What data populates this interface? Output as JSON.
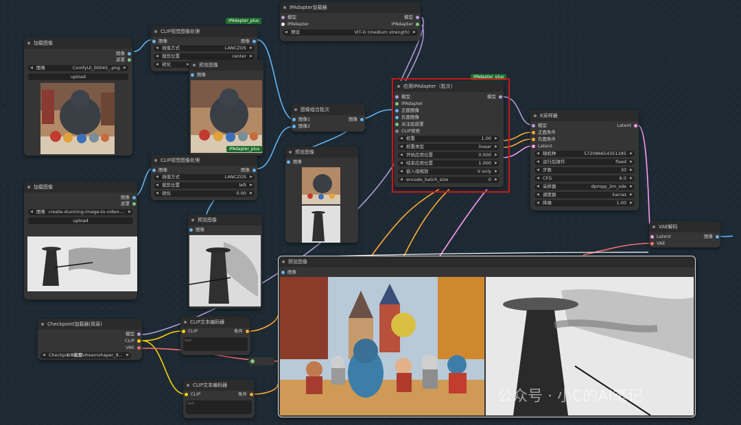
{
  "badges": {
    "ipadapter_plus_1": "IPAdapter_plus",
    "ipadapter_plus_2": "IPAdapter_plus",
    "ipadapter_plus_3": "IPAdapter_plus"
  },
  "load_image_1": {
    "title": "加载图像",
    "out_image": "图像",
    "out_mask": "遮罩",
    "image_label": "图像",
    "image_value": "ComfyUI_00045_.png",
    "upload": "upload"
  },
  "load_image_2": {
    "title": "加载图像",
    "out_image": "图像",
    "out_mask": "遮罩",
    "image_label": "图像",
    "image_value": "create-stunning-image-to-video-...",
    "upload": "upload"
  },
  "clip_prep_1": {
    "title": "CLIP视觉图像处理",
    "in_image": "图像",
    "out_image": "图像",
    "w1_label": "插值方式",
    "w1_value": "LANCZOS",
    "w2_label": "裁剪位置",
    "w2_value": "center",
    "w3_label": "锐化"
  },
  "clip_prep_2": {
    "title": "CLIP视觉图像处理",
    "in_image": "图像",
    "out_image": "图像",
    "w1_label": "插值方式",
    "w1_value": "LANCZOS",
    "w2_label": "裁剪位置",
    "w2_value": "left",
    "w3_label": "锐化",
    "w3_value": "0.00"
  },
  "preview_1": {
    "title": "预览图像",
    "in_image": "图像"
  },
  "preview_2": {
    "title": "预览图像",
    "in_image": "图像"
  },
  "preview_3": {
    "title": "预览图像",
    "in_image": "图像"
  },
  "preview_4": {
    "title": "预览图像",
    "in_image": "图像"
  },
  "batch": {
    "title": "图像组合批次",
    "in1": "图像1",
    "in2": "图像2",
    "out": "图像"
  },
  "ipa_loader": {
    "title": "IPAdapter加载器",
    "in_model": "模型",
    "in_ipa": "IPAdapter",
    "out_model": "模型",
    "out_ipa": "IPAdapter",
    "preset_label": "预设",
    "preset_value": "VIT-G (medium strength)"
  },
  "apply_ipa": {
    "title": "应用IPAdapter（批次）",
    "inputs": [
      "模型",
      "IPAdapter",
      "正面图像",
      "负面图像",
      "关注层遮罩",
      "CLIP视觉"
    ],
    "out_model": "模型",
    "widgets": [
      {
        "label": "权重",
        "value": "1.00"
      },
      {
        "label": "权重类型",
        "value": "linear"
      },
      {
        "label": "开始应用位置",
        "value": "0.000"
      },
      {
        "label": "结束应用位置",
        "value": "1.000"
      },
      {
        "label": "嵌入组缩放",
        "value": "V only"
      },
      {
        "label": "encode_batch_size",
        "value": "0"
      }
    ]
  },
  "ksampler": {
    "title": "K采样器",
    "inputs": [
      "模型",
      "正面条件",
      "负面条件",
      "Latent"
    ],
    "out": "Latent",
    "widgets": [
      {
        "label": "随机种",
        "value": "572086654351285"
      },
      {
        "label": "运行后操作",
        "value": "fixed"
      },
      {
        "label": "步数",
        "value": "30"
      },
      {
        "label": "CFG",
        "value": "6.0"
      },
      {
        "label": "采样器",
        "value": "dpmpp_2m_sde"
      },
      {
        "label": "调度器",
        "value": "karras"
      },
      {
        "label": "降噪",
        "value": "1.00"
      }
    ]
  },
  "vae_decode": {
    "title": "VAE解码",
    "in_latent": "Latent",
    "in_vae": "VAE",
    "out": "图像"
  },
  "checkpoint": {
    "title": "Checkpoint加载器(简易)",
    "out_model": "模型",
    "out_clip": "CLIP",
    "out_vae": "VAE",
    "ckpt_label": "Checkpoint名称",
    "ckpt_value": "1.5模型\\dreamshaper_8..."
  },
  "clip_text_1": {
    "title": "CLIP文本编码器",
    "in_clip": "CLIP",
    "out": "条件",
    "text": "text"
  },
  "clip_text_2": {
    "title": "CLIP文本编码器",
    "in_clip": "CLIP",
    "out": "条件",
    "text": "text"
  },
  "big_preview": {
    "title": "预览图像",
    "in_image": "图像"
  },
  "watermark": "公众号 · 小C的AI笔记",
  "colors": {
    "image_port": "#64b5f6",
    "model_port": "#b39ddb",
    "clip_port": "#ffd500",
    "vae_port": "#ff6e6e",
    "cond_port": "#ffa931",
    "latent_port": "#ff9cf9",
    "mask_port": "#81c784",
    "ipa_port": "#ffffff",
    "highlight": "#c81818"
  }
}
